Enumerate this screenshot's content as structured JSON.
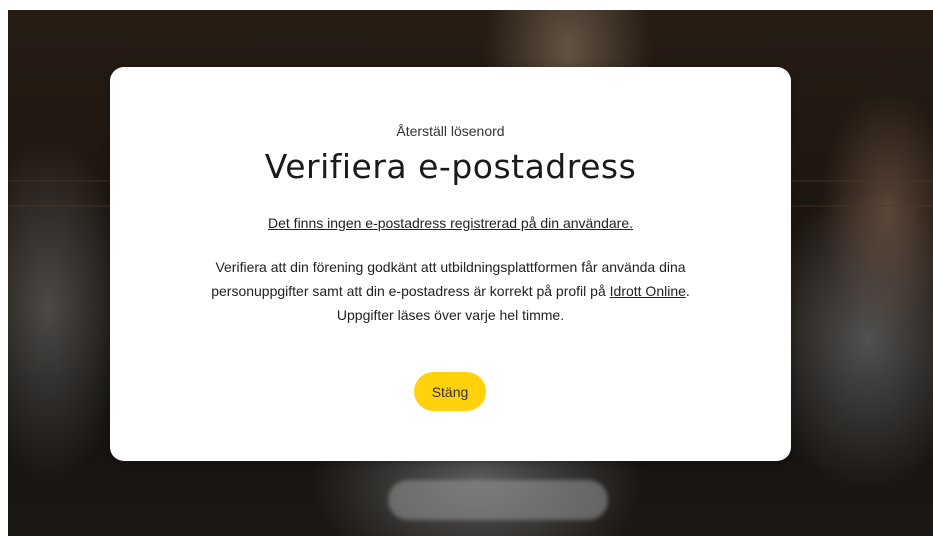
{
  "modal": {
    "eyebrow": "Återställ lösenord",
    "title": "Verifiera e-postadress",
    "warning": "Det finns ingen e-postadress registrerad på din användare.",
    "body_line1": "Verifiera att din förening godkänt att utbildningsplattformen får använda dina",
    "body_line2_prefix": "personuppgifter samt att din e-postadress är korrekt på profil på ",
    "body_link": "Idrott Online",
    "body_line2_suffix": ".",
    "body_line3": "Uppgifter läses över varje hel timme.",
    "close_label": "Stäng"
  },
  "colors": {
    "button": "#ffd20c",
    "modal_background": "#ffffff",
    "backdrop": "#2a2119"
  }
}
